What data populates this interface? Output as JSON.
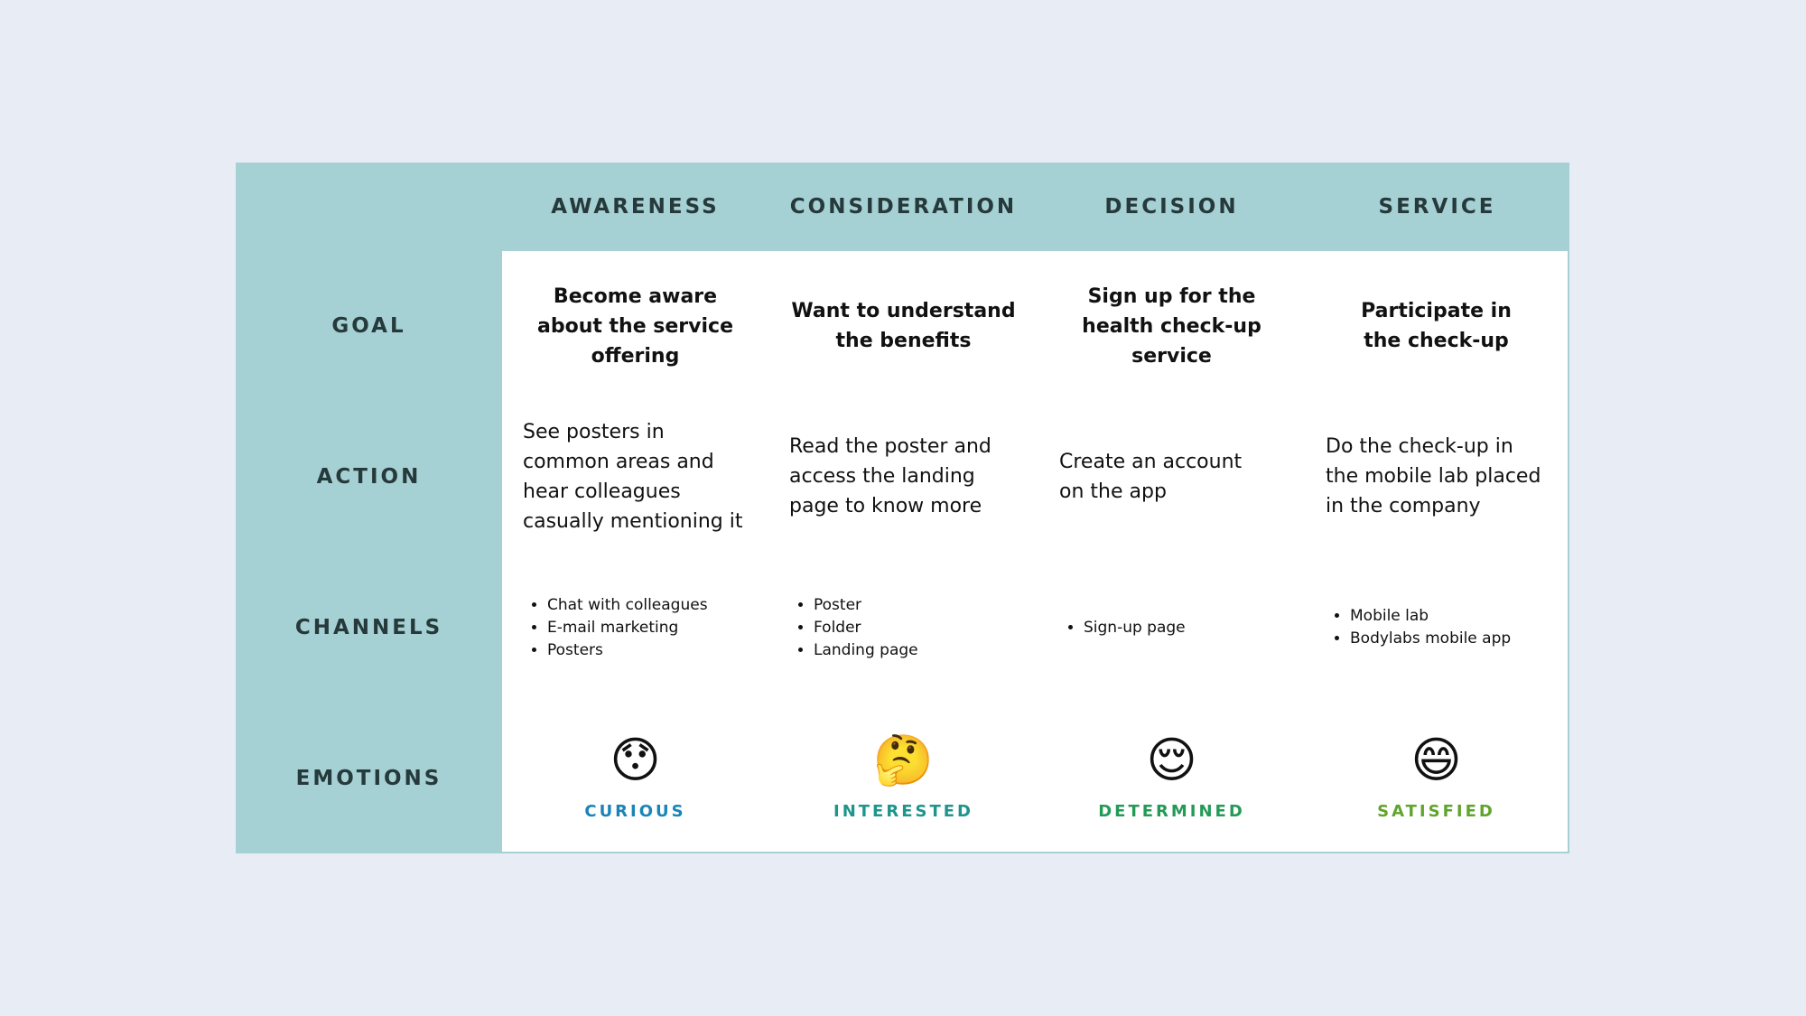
{
  "colors": {
    "page_background": "#e8edf5",
    "board_background": "#a6d1d4",
    "heading_text": "#26393b",
    "curious": "#1a84b8",
    "interested": "#1d958c",
    "determined": "#249a57",
    "satisfied": "#5fa52d"
  },
  "stages": [
    {
      "name": "AWARENESS",
      "goal": "Become aware about the service offering",
      "action": "See posters in common areas and hear colleagues casually mentioning it",
      "channels": [
        "Chat with colleagues",
        "E-mail marketing",
        "Posters"
      ],
      "emotion": {
        "icon": "hushed-face-icon",
        "glyph": "😯",
        "label": "CURIOUS"
      }
    },
    {
      "name": "CONSIDERATION",
      "goal": "Want to understand the benefits",
      "action": "Read the poster and access the landing page to know more",
      "channels": [
        "Poster",
        "Folder",
        "Landing page"
      ],
      "emotion": {
        "icon": "thinking-face-icon",
        "glyph": "🤔",
        "label": "INTERESTED"
      }
    },
    {
      "name": "DECISION",
      "goal": "Sign up for the health check-up service",
      "action": "Create an account on the app",
      "channels": [
        "Sign-up page"
      ],
      "emotion": {
        "icon": "relieved-face-icon",
        "glyph": "😌",
        "label": "DETERMINED"
      }
    },
    {
      "name": "SERVICE",
      "goal": "Participate in the check-up",
      "action": "Do the check-up in the mobile lab placed in the company",
      "channels": [
        "Mobile lab",
        "Bodylabs mobile app"
      ],
      "emotion": {
        "icon": "grinning-smiling-eyes-icon",
        "glyph": "😄",
        "label": "SATISFIED"
      }
    }
  ],
  "row_labels": {
    "goal": "GOAL",
    "action": "ACTION",
    "channels": "CHANNELS",
    "emotions": "EMOTIONS"
  }
}
